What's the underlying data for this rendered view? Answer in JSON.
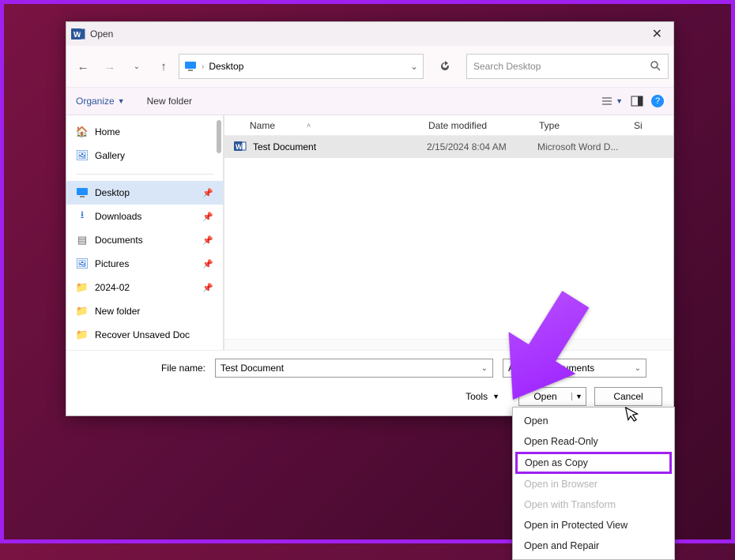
{
  "window": {
    "title": "Open"
  },
  "nav": {
    "location": "Desktop",
    "search_placeholder": "Search Desktop"
  },
  "toolbar": {
    "organize": "Organize",
    "newfolder": "New folder"
  },
  "sidebar": {
    "home": "Home",
    "gallery": "Gallery",
    "desktop": "Desktop",
    "downloads": "Downloads",
    "documents": "Documents",
    "pictures": "Pictures",
    "month": "2024-02",
    "newfolder": "New folder",
    "recover": "Recover Unsaved Doc"
  },
  "columns": {
    "name": "Name",
    "date": "Date modified",
    "type": "Type",
    "size": "Si"
  },
  "files": [
    {
      "name": "Test Document",
      "date": "2/15/2024 8:04 AM",
      "type": "Microsoft Word D..."
    }
  ],
  "footer": {
    "filename_label": "File name:",
    "filename_value": "Test Document",
    "filter": "All Word Documents",
    "tools": "Tools",
    "open": "Open",
    "cancel": "Cancel"
  },
  "menu": {
    "open": "Open",
    "readonly": "Open Read-Only",
    "copy": "Open as Copy",
    "browser": "Open in Browser",
    "transform": "Open with Transform",
    "protected": "Open in Protected View",
    "repair": "Open and Repair"
  }
}
